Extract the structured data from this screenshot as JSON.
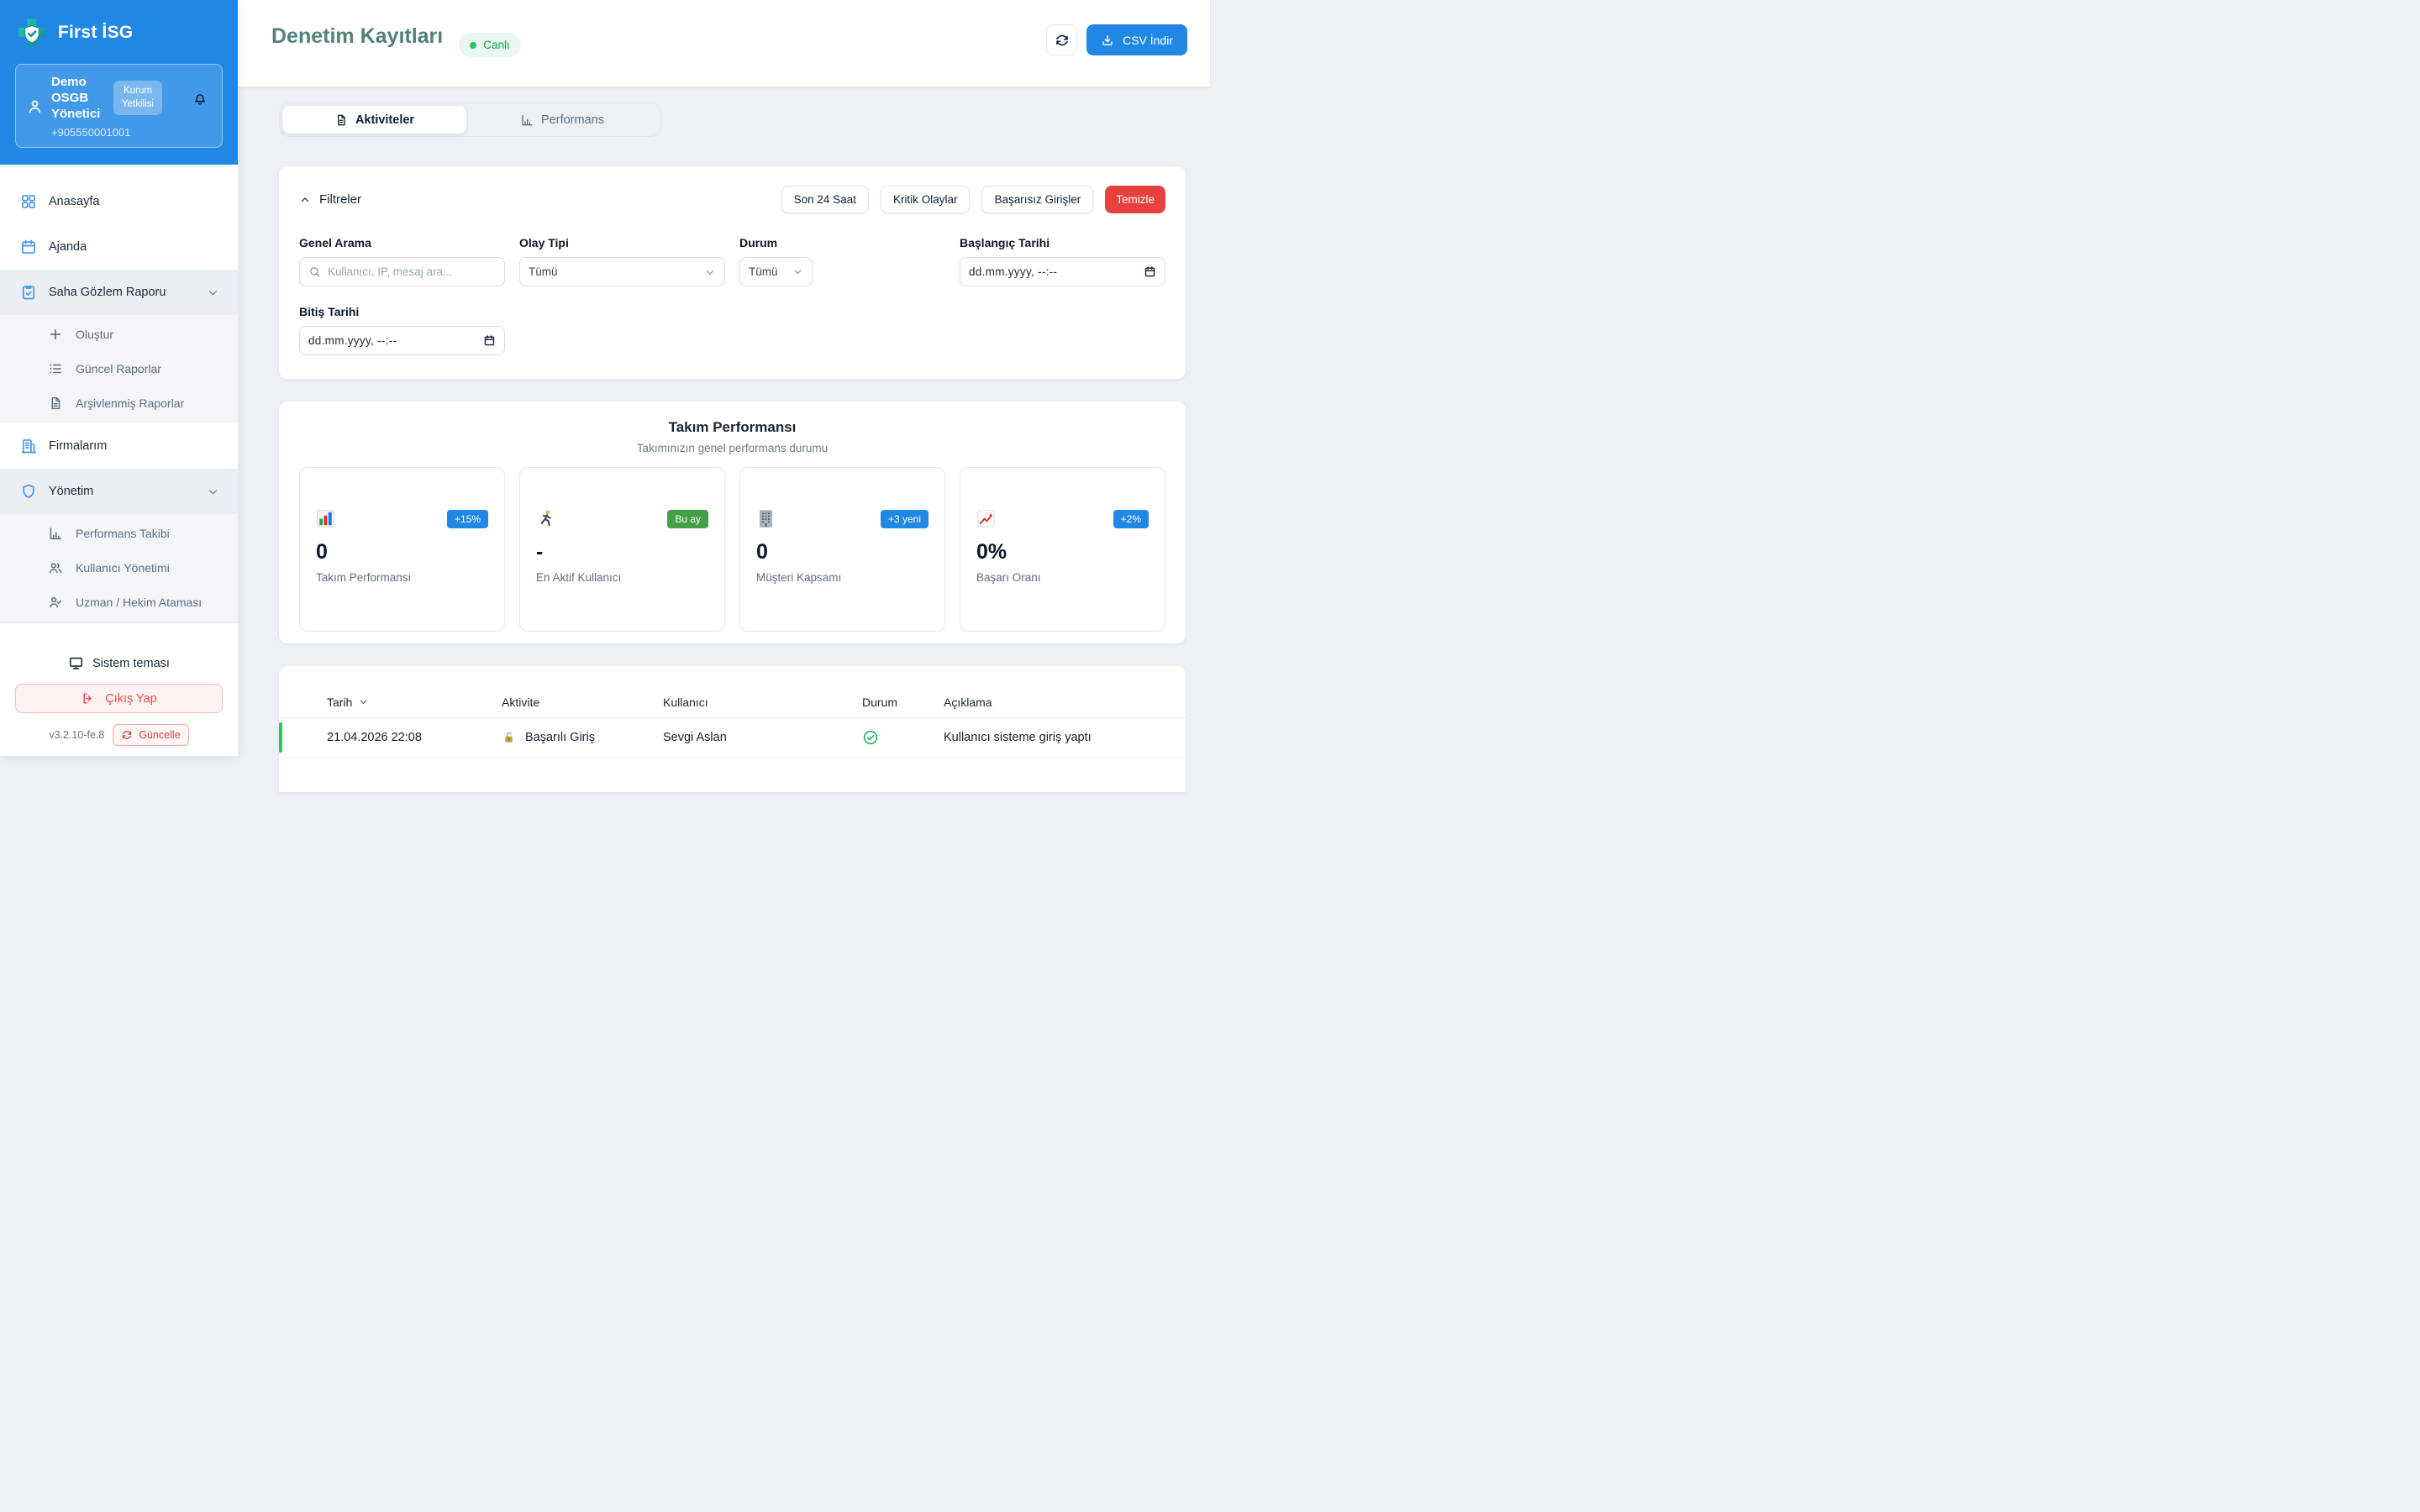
{
  "sidebar": {
    "brand": "First İSG",
    "user": {
      "name": "Demo OSGB Yönetici",
      "role_badge": "Kurum Yetkilisi",
      "phone": "+905550001001"
    },
    "nav": {
      "home": "Anasayfa",
      "agenda": "Ajanda",
      "field_report": "Saha Gözlem Raporu",
      "create": "Oluştur",
      "current_reports": "Güncel Raporlar",
      "archived_reports": "Arşivlenmiş Raporlar",
      "companies": "Firmalarım",
      "management": "Yönetim",
      "performance_tracking": "Performans Takibi",
      "user_management": "Kullanıcı Yönetimi",
      "expert_assignment": "Uzman / Hekim Ataması"
    },
    "theme_label": "Sistem teması",
    "logout_label": "Çıkış Yap",
    "version": "v3.2.10-fe.8",
    "update_label": "Güncelle"
  },
  "header": {
    "title": "Denetim Kayıtları",
    "live_badge": "Canlı",
    "csv_button": "CSV İndir"
  },
  "tabs": {
    "activities": "Aktiviteler",
    "performance": "Performans"
  },
  "filters": {
    "title": "Filtreler",
    "quick": [
      "Son 24 Saat",
      "Kritik Olaylar",
      "Başarısız Girişler"
    ],
    "clear": "Temizle",
    "fields": {
      "search": {
        "label": "Genel Arama",
        "placeholder": "Kullanıcı, IP, mesaj ara..."
      },
      "event_type": {
        "label": "Olay Tipi",
        "value": "Tümü"
      },
      "status": {
        "label": "Durum",
        "value": "Tümü"
      },
      "start_date": {
        "label": "Başlangıç Tarihi",
        "placeholder": "dd.mm.yyyy, --:--"
      },
      "end_date": {
        "label": "Bitiş Tarihi",
        "placeholder": "dd.mm.yyyy, --:--"
      }
    }
  },
  "team": {
    "title": "Takım Performansı",
    "subtitle": "Takımınızın genel performans durumu",
    "cards": [
      {
        "icon": "bar-chart-emoji",
        "badge": "+15%",
        "badge_color": "#2187e5",
        "value": "0",
        "label": "Takım Performansı"
      },
      {
        "icon": "runner-emoji",
        "badge": "Bu ay",
        "badge_color": "#43a047",
        "value": "-",
        "label": "En Aktif Kullanıcı"
      },
      {
        "icon": "office-building-emoji",
        "badge": "+3 yeni",
        "badge_color": "#2187e5",
        "value": "0",
        "label": "Müşteri Kapsamı"
      },
      {
        "icon": "chart-increasing-emoji",
        "badge": "+2%",
        "badge_color": "#2187e5",
        "value": "0%",
        "label": "Başarı Oranı"
      }
    ]
  },
  "table": {
    "columns": [
      "Tarih",
      "Aktivite",
      "Kullanıcı",
      "Durum",
      "Açıklama"
    ],
    "rows": [
      {
        "date": "21.04.2026 22:08",
        "activity": "Başarılı Giriş",
        "user": "Sevgi Aslan",
        "status": "success",
        "description": "Kullanıcı sisteme giriş yaptı"
      }
    ]
  },
  "colors": {
    "sidebar_blue": "#2187e5",
    "accent_blue": "#2187e5",
    "danger_red": "#e8403d",
    "success_green": "#2fc264",
    "badge_green": "#43a047",
    "title_teal": "#53807d",
    "live_text_green": "#17a049"
  }
}
